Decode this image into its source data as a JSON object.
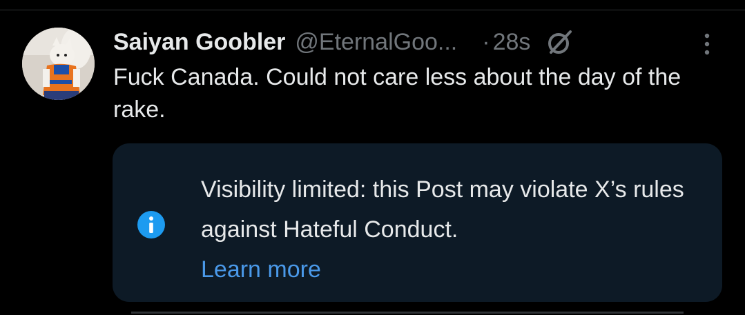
{
  "post": {
    "author": {
      "display_name": "Saiyan Goobler",
      "handle": "@EternalGoo..."
    },
    "separator": "·",
    "timestamp": "28s",
    "text": "Fuck Canada. Could not care less about the day of the rake.",
    "notice": {
      "message": "Visibility limited: this Post may violate X’s rules against Hateful Conduct.",
      "link_label": "Learn more",
      "icon": "info-icon"
    }
  },
  "colors": {
    "background": "#000000",
    "primary_text": "#e7e9ea",
    "secondary_text": "#71767b",
    "notice_background": "#0d1a26",
    "link": "#4a99e9",
    "info_icon": "#1d9bf0"
  },
  "icons": [
    "avatar-image",
    "grok-icon",
    "more-icon",
    "info-icon"
  ]
}
